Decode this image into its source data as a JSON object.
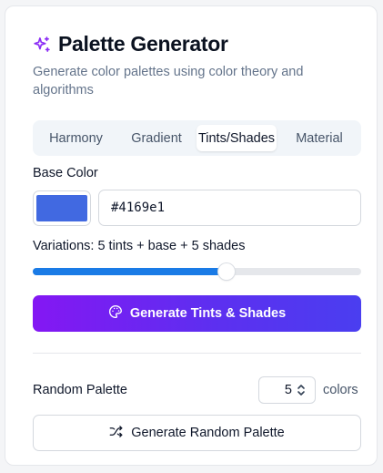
{
  "header": {
    "title": "Palette Generator",
    "subtitle": "Generate color palettes using color theory and algorithms",
    "icon": "sparkles-icon",
    "icon_color": "#8b2cf5"
  },
  "tabs": [
    {
      "label": "Harmony",
      "active": false
    },
    {
      "label": "Gradient",
      "active": false
    },
    {
      "label": "Tints/Shades",
      "active": true
    },
    {
      "label": "Material",
      "active": false
    }
  ],
  "base_color": {
    "label": "Base Color",
    "value": "#4169e1",
    "swatch_color": "#4169e1"
  },
  "variations": {
    "label": "Variations: 5 tints + base + 5 shades",
    "slider_fraction": 0.59,
    "fill_color": "#1a7be6"
  },
  "generate_button": {
    "label": "Generate Tints & Shades",
    "icon": "palette-icon",
    "gradient": [
      "#8417f3",
      "#4a3ef0"
    ]
  },
  "random": {
    "label": "Random Palette",
    "count": "5",
    "unit_label": "colors",
    "button_label": "Generate Random Palette",
    "button_icon": "shuffle-icon"
  }
}
